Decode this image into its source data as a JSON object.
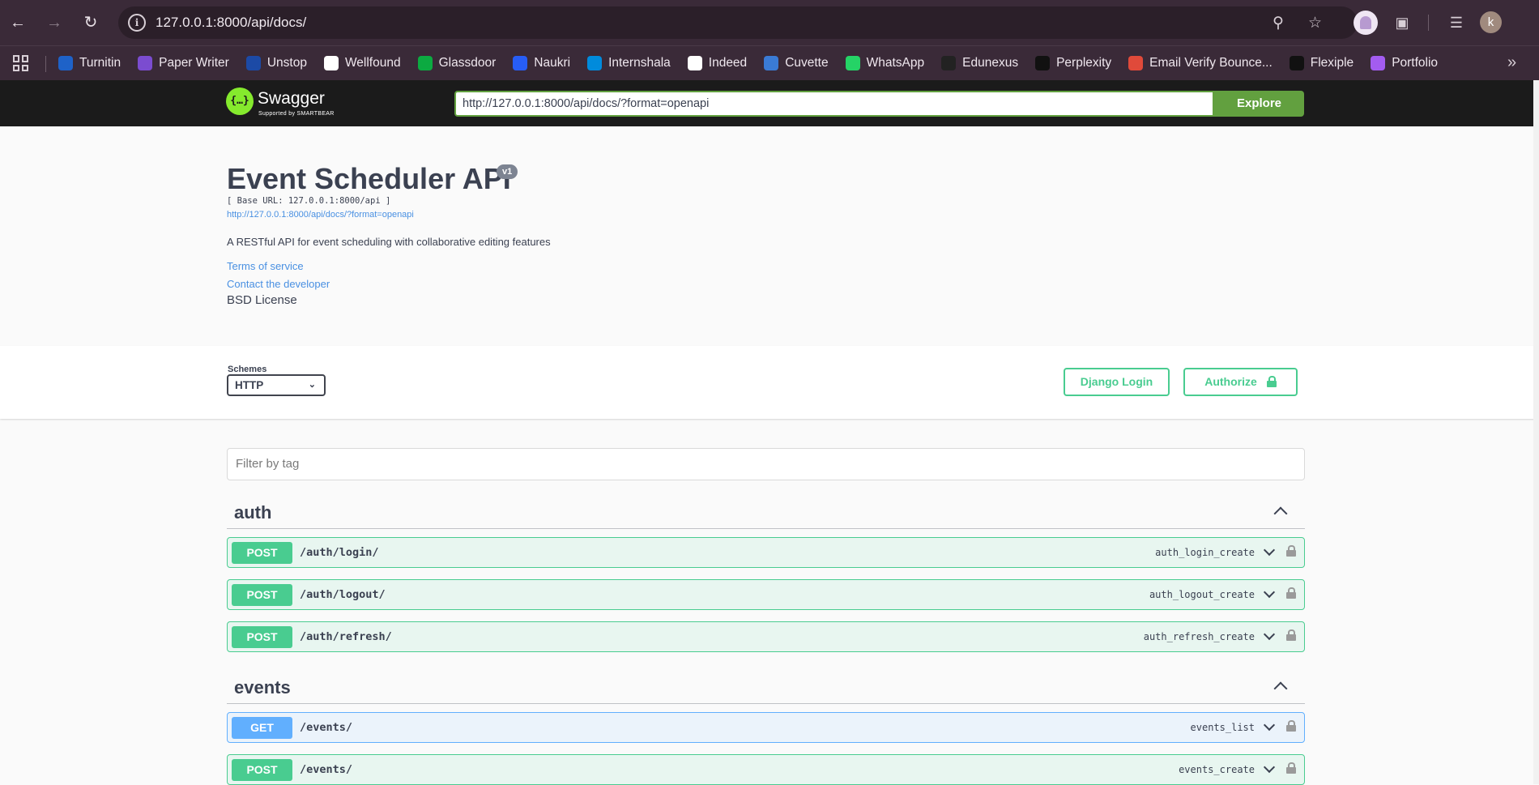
{
  "browser": {
    "url": "127.0.0.1:8000/api/docs/",
    "bookmarks": [
      {
        "label": "Turnitin",
        "icon": "turnitin-icon",
        "color": "#1e62c8"
      },
      {
        "label": "Paper Writer",
        "icon": "paperwriter-icon",
        "color": "#7b4cd0"
      },
      {
        "label": "Unstop",
        "icon": "unstop-icon",
        "color": "#1c4aa6"
      },
      {
        "label": "Wellfound",
        "icon": "wellfound-icon",
        "color": "#ffffff"
      },
      {
        "label": "Glassdoor",
        "icon": "glassdoor-icon",
        "color": "#0caa41"
      },
      {
        "label": "Naukri",
        "icon": "naukri-icon",
        "color": "#275df5"
      },
      {
        "label": "Internshala",
        "icon": "internshala-icon",
        "color": "#008bdc"
      },
      {
        "label": "Indeed",
        "icon": "indeed-icon",
        "color": "#ffffff"
      },
      {
        "label": "Cuvette",
        "icon": "cuvette-icon",
        "color": "#3a7bd5"
      },
      {
        "label": "WhatsApp",
        "icon": "whatsapp-icon",
        "color": "#25d366"
      },
      {
        "label": "Edunexus",
        "icon": "github-icon",
        "color": "#222222"
      },
      {
        "label": "Perplexity",
        "icon": "perplexity-icon",
        "color": "#111111"
      },
      {
        "label": "Email Verify Bounce...",
        "icon": "emailverify-icon",
        "color": "#e04a3a"
      },
      {
        "label": "Flexiple",
        "icon": "flexiple-icon",
        "color": "#111111"
      },
      {
        "label": "Portfolio",
        "icon": "portfolio-icon",
        "color": "#a35cf0"
      }
    ],
    "profile_initial": "k"
  },
  "swagger": {
    "brand": "Swagger",
    "brand_sub": "Supported by SMARTBEAR",
    "spec_url": "http://127.0.0.1:8000/api/docs/?format=openapi",
    "explore_label": "Explore"
  },
  "info": {
    "title": "Event Scheduler API",
    "version": "v1",
    "base_url": "[ Base URL: 127.0.0.1:8000/api ]",
    "spec_link": "http://127.0.0.1:8000/api/docs/?format=openapi",
    "description": "A RESTful API for event scheduling with collaborative editing features",
    "terms": "Terms of service",
    "contact": "Contact the developer",
    "license": "BSD License"
  },
  "schemes": {
    "label": "Schemes",
    "selected": "HTTP",
    "django_login": "Django Login",
    "authorize": "Authorize"
  },
  "filter": {
    "placeholder": "Filter by tag"
  },
  "tags": [
    {
      "name": "auth",
      "operations": [
        {
          "method": "POST",
          "path": "/auth/login/",
          "id": "auth_login_create"
        },
        {
          "method": "POST",
          "path": "/auth/logout/",
          "id": "auth_logout_create"
        },
        {
          "method": "POST",
          "path": "/auth/refresh/",
          "id": "auth_refresh_create"
        }
      ]
    },
    {
      "name": "events",
      "operations": [
        {
          "method": "GET",
          "path": "/events/",
          "id": "events_list"
        },
        {
          "method": "POST",
          "path": "/events/",
          "id": "events_create"
        }
      ]
    }
  ]
}
